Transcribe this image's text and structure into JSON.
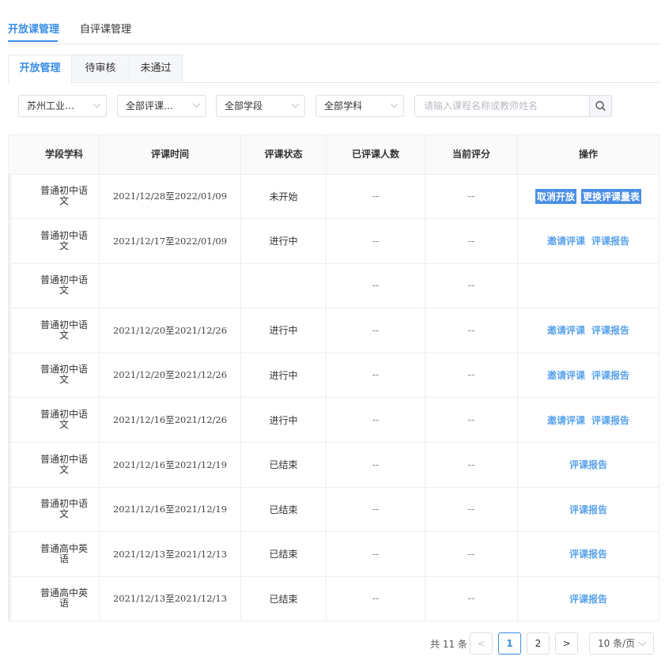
{
  "top_tabs": [
    {
      "label": "开放课管理",
      "active": true
    },
    {
      "label": "自评课管理",
      "active": false
    }
  ],
  "sub_tabs": [
    {
      "label": "开放管理",
      "active": true
    },
    {
      "label": "待审核",
      "active": false
    },
    {
      "label": "未通过",
      "active": false
    }
  ],
  "filters": {
    "school": "苏州工业…",
    "evaluation_type": "全部评课…",
    "stage": "全部学段",
    "subject": "全部学科",
    "search_placeholder": "请输入课程名称或教师姓名"
  },
  "table": {
    "headers": [
      "学段学科",
      "评课时间",
      "评课状态",
      "已评课人数",
      "当前评分",
      "操作"
    ],
    "rows": [
      {
        "subject": "普通初中语文",
        "time": "2021/12/28至2022/01/09",
        "status": "未开始",
        "count": "--",
        "score": "--",
        "actions": [
          "取消开放",
          "更换评课量表"
        ]
      },
      {
        "subject": "普通初中语文",
        "time": "2021/12/17至2022/01/09",
        "status": "进行中",
        "count": "--",
        "score": "--",
        "actions": [
          "邀请评课",
          "评课报告"
        ]
      },
      {
        "subject": "普通初中语文",
        "time": "",
        "status": "",
        "count": "--",
        "score": "--",
        "actions": []
      },
      {
        "subject": "普通初中语文",
        "time": "2021/12/20至2021/12/26",
        "status": "进行中",
        "count": "--",
        "score": "--",
        "actions": [
          "邀请评课",
          "评课报告"
        ]
      },
      {
        "subject": "普通初中语文",
        "time": "2021/12/20至2021/12/26",
        "status": "进行中",
        "count": "--",
        "score": "--",
        "actions": [
          "邀请评课",
          "评课报告"
        ]
      },
      {
        "subject": "普通初中语文",
        "time": "2021/12/16至2021/12/26",
        "status": "进行中",
        "count": "--",
        "score": "--",
        "actions": [
          "邀请评课",
          "评课报告"
        ]
      },
      {
        "subject": "普通初中语文",
        "time": "2021/12/16至2021/12/19",
        "status": "已结束",
        "count": "--",
        "score": "--",
        "actions": [
          "评课报告"
        ]
      },
      {
        "subject": "普通初中语文",
        "time": "2021/12/16至2021/12/19",
        "status": "已结束",
        "count": "--",
        "score": "--",
        "actions": [
          "评课报告"
        ]
      },
      {
        "subject": "普通高中英语",
        "time": "2021/12/13至2021/12/13",
        "status": "已结束",
        "count": "--",
        "score": "--",
        "actions": [
          "评课报告"
        ]
      },
      {
        "subject": "普通高中英语",
        "time": "2021/12/13至2021/12/13",
        "status": "已结束",
        "count": "--",
        "score": "--",
        "actions": [
          "评课报告"
        ]
      }
    ]
  },
  "pagination": {
    "total_text": "共 11 条",
    "prev": "<",
    "pages": [
      "1",
      "2"
    ],
    "current_page": "1",
    "next": ">",
    "page_size": "10 条/页"
  },
  "colors": {
    "accent": "#3a8ee6",
    "link": "#5aa3ea",
    "highlight": "#4a8fe6"
  },
  "icons": {
    "search": "search-icon",
    "dropdown": "chevron-down-icon"
  }
}
